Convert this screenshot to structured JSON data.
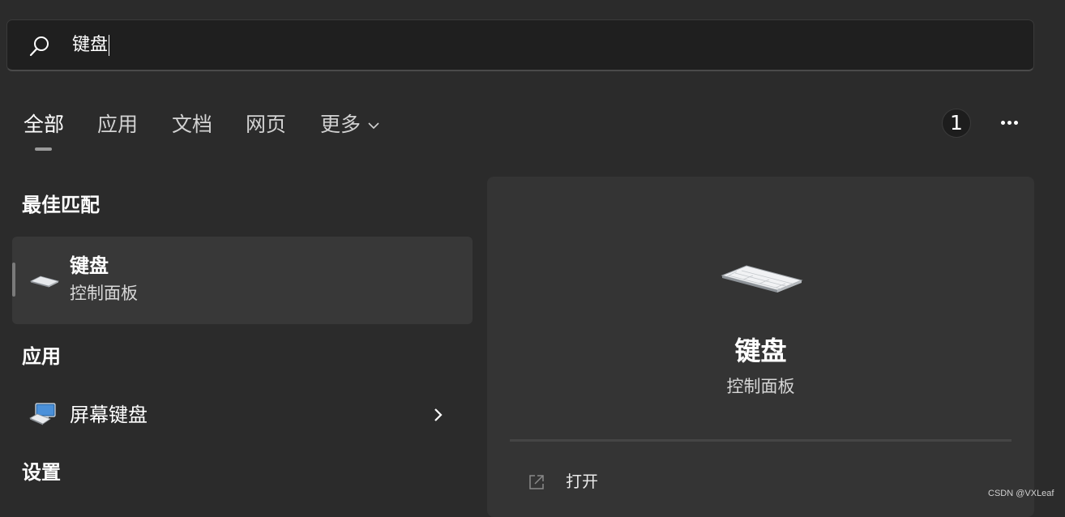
{
  "search": {
    "query": "键盘",
    "icon": "search-icon"
  },
  "tabs": [
    {
      "label": "全部",
      "active": true
    },
    {
      "label": "应用"
    },
    {
      "label": "文档"
    },
    {
      "label": "网页"
    },
    {
      "label": "更多"
    }
  ],
  "header_actions": {
    "badge_count": "1",
    "more_icon": "more-horizontal-icon"
  },
  "best_match": {
    "heading": "最佳匹配",
    "title": "键盘",
    "subtitle": "控制面板",
    "icon": "keyboard-icon"
  },
  "apps": {
    "heading": "应用",
    "items": [
      {
        "label": "屏幕键盘",
        "icon": "onscreen-keyboard-icon"
      }
    ]
  },
  "settings": {
    "heading": "设置"
  },
  "preview": {
    "title": "键盘",
    "subtitle": "控制面板",
    "icon": "keyboard-icon",
    "actions": [
      {
        "label": "打开",
        "icon": "open-external-icon"
      }
    ]
  },
  "watermark": "CSDN @VXLeaf",
  "colors": {
    "background": "#2b2b2b",
    "search_bg": "#1f1f1f",
    "selected_item": "#383838",
    "preview_panel": "#343434"
  }
}
